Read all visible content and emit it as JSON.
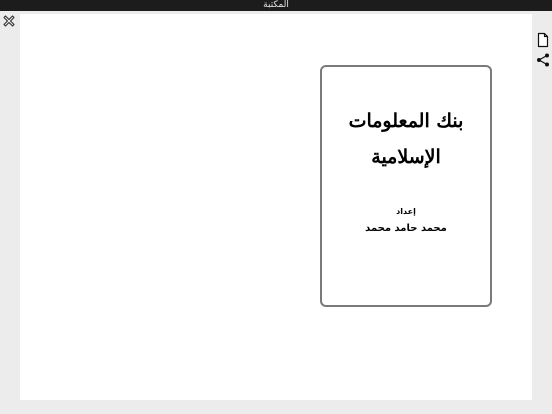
{
  "window": {
    "title": "المكتبة"
  },
  "toolbar": {
    "close_icon": "close-icon",
    "document_icon": "document-icon",
    "share_icon": "share-icon"
  },
  "book": {
    "title_line_1": "بنك المعلومات",
    "title_line_2": "الإسلامية",
    "prepared_by_label": "إعداد",
    "author": "محمد حامد محمد"
  },
  "colors": {
    "title_bar": "#1c1c1c",
    "background": "#ececec",
    "page": "#ffffff",
    "cover_border": "#7a7a7a"
  }
}
